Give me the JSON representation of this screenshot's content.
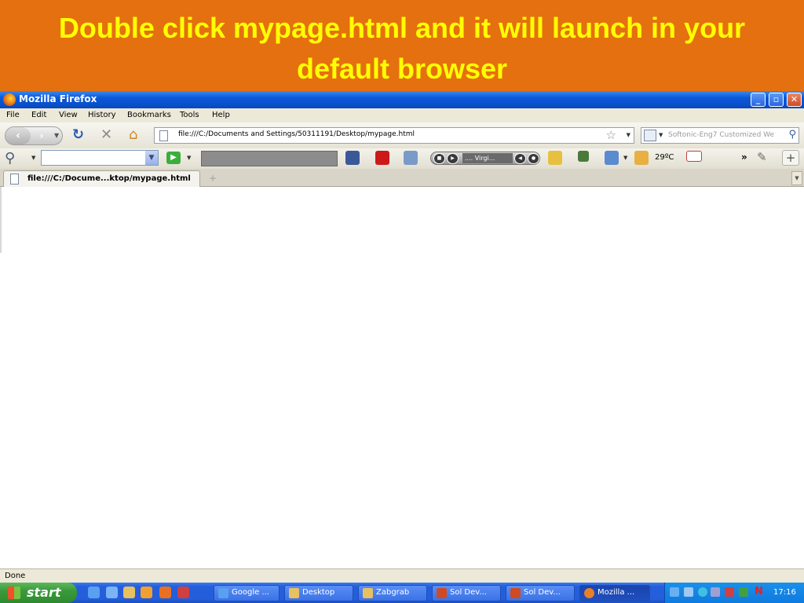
{
  "slide": {
    "title": "Double click mypage.html and it will launch in your default browser"
  },
  "browser": {
    "window_title": "Mozilla Firefox",
    "window_buttons": {
      "minimize": "_",
      "restore": "▫",
      "close": "✕"
    },
    "menu": [
      "File",
      "Edit",
      "View",
      "History",
      "Bookmarks",
      "Tools",
      "Help"
    ],
    "navbar": {
      "url": "file:///C:/Documents and Settings/50311191/Desktop/mypage.html",
      "search_placeholder": "Softonic-Eng7 Customized We"
    },
    "toolbar": {
      "player_track": ".... Virgi...",
      "weather": "29ºC",
      "more": "»"
    },
    "tabs": [
      {
        "label": "file:///C:/Docume...ktop/mypage.html"
      }
    ],
    "status": "Done"
  },
  "taskbar": {
    "start_label": "start",
    "tasks": [
      {
        "label": "Google ..."
      },
      {
        "label": "Desktop"
      },
      {
        "label": "Zabgrab"
      },
      {
        "label": "Sol Dev..."
      },
      {
        "label": "Sol Dev..."
      },
      {
        "label": "Mozilla ..."
      }
    ],
    "clock": "17:16"
  },
  "icons": {
    "titlebar": "firefox-logo-icon",
    "nav": [
      "back-arrow-icon",
      "forward-arrow-icon",
      "reload-icon",
      "stop-icon",
      "home-icon",
      "page-icon",
      "bookmark-star-icon"
    ],
    "toolbar": [
      "magnifier-icon",
      "facebook-icon",
      "youtube-icon",
      "games-icon",
      "weather-icon",
      "tv-icon",
      "mail-icon",
      "wrench-icon"
    ]
  },
  "colors": {
    "banner_bg": "#e5700f",
    "banner_text": "#ffff00",
    "xp_titlebar": "#0a58d8",
    "xp_taskbar": "#245edb",
    "start_green": "#3a9a3a"
  }
}
